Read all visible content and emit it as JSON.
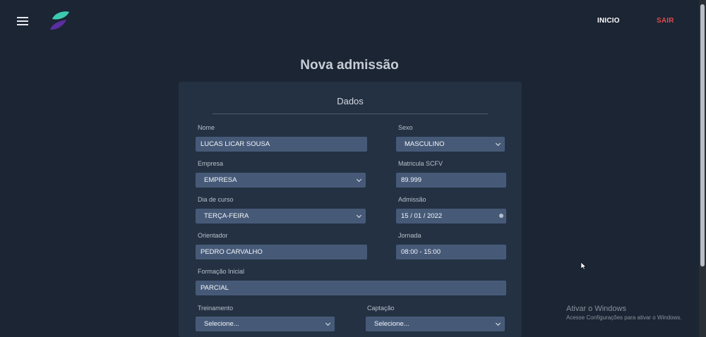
{
  "nav": {
    "inicio": "INICIO",
    "sair": "SAIR"
  },
  "page": {
    "title": "Nova admissão"
  },
  "form": {
    "section_title": "Dados",
    "nome": {
      "label": "Nome",
      "value": "LUCAS LICAR SOUSA"
    },
    "sexo": {
      "label": "Sexo",
      "value": "MASCULINO"
    },
    "empresa": {
      "label": "Empresa",
      "value": "EMPRESA"
    },
    "matricula": {
      "label": "Matricula SCFV",
      "value": "89.999"
    },
    "dia_curso": {
      "label": "Dia de curso",
      "value": "TERÇA-FEIRA"
    },
    "admissao": {
      "label": "Admissão",
      "value": "15 / 01 / 2022"
    },
    "orientador": {
      "label": "Orientador",
      "value": "PEDRO CARVALHO"
    },
    "jornada": {
      "label": "Jornada",
      "value": "08:00 - 15:00"
    },
    "formacao": {
      "label": "Formação Inicial",
      "value": "PARCIAL"
    },
    "treinamento": {
      "label": "Treinamento",
      "value": "Selecione..."
    },
    "captacao": {
      "label": "Captação",
      "value": "Selecione..."
    }
  },
  "watermark": {
    "title": "Ativar o Windows",
    "subtitle": "Acesse Configurações para ativar o Windows."
  },
  "colors": {
    "accent": "#e0474c",
    "field_bg": "#465a78",
    "card_bg": "#243142",
    "page_bg": "#1b2533"
  }
}
